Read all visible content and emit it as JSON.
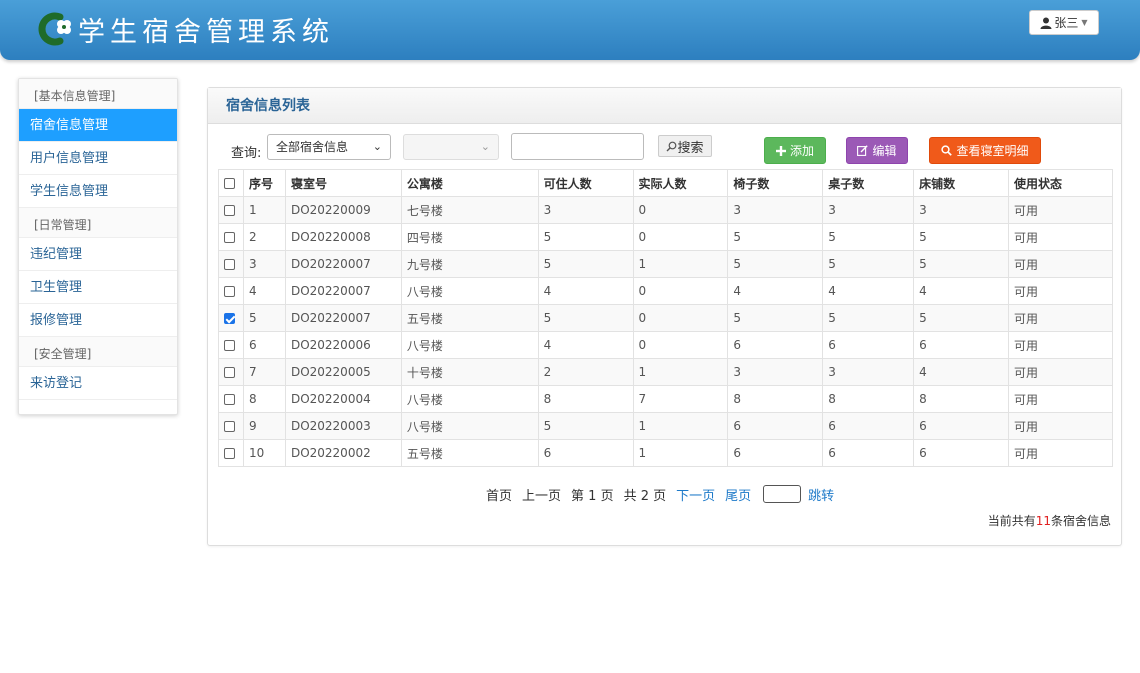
{
  "header": {
    "title": "学生宿舍管理系统",
    "user_label": "张三"
  },
  "sidebar": {
    "groups": [
      {
        "label": "[基本信息管理]",
        "items": [
          "宿舍信息管理",
          "用户信息管理",
          "学生信息管理"
        ]
      },
      {
        "label": "[日常管理]",
        "items": [
          "违纪管理",
          "卫生管理",
          "报修管理"
        ]
      },
      {
        "label": "[安全管理]",
        "items": [
          "来访登记"
        ]
      }
    ],
    "active_item": "宿舍信息管理"
  },
  "panel": {
    "title": "宿舍信息列表"
  },
  "toolbar": {
    "query_label": "查询:",
    "filter_select_value": "全部宿舍信息",
    "second_select_value": "",
    "search_input_value": "",
    "search_label": "搜索",
    "add_label": "添加",
    "edit_label": "编辑",
    "detail_label": "查看寝室明细"
  },
  "table": {
    "headers": [
      "序号",
      "寝室号",
      "公寓楼",
      "可住人数",
      "实际人数",
      "椅子数",
      "桌子数",
      "床铺数",
      "使用状态"
    ],
    "rows": [
      {
        "checked": false,
        "cells": [
          "1",
          "DO20220009",
          "七号楼",
          "3",
          "0",
          "3",
          "3",
          "3",
          "可用"
        ]
      },
      {
        "checked": false,
        "cells": [
          "2",
          "DO20220008",
          "四号楼",
          "5",
          "0",
          "5",
          "5",
          "5",
          "可用"
        ]
      },
      {
        "checked": false,
        "cells": [
          "3",
          "DO20220007",
          "九号楼",
          "5",
          "1",
          "5",
          "5",
          "5",
          "可用"
        ]
      },
      {
        "checked": false,
        "cells": [
          "4",
          "DO20220007",
          "八号楼",
          "4",
          "0",
          "4",
          "4",
          "4",
          "可用"
        ]
      },
      {
        "checked": true,
        "cells": [
          "5",
          "DO20220007",
          "五号楼",
          "5",
          "0",
          "5",
          "5",
          "5",
          "可用"
        ]
      },
      {
        "checked": false,
        "cells": [
          "6",
          "DO20220006",
          "八号楼",
          "4",
          "0",
          "6",
          "6",
          "6",
          "可用"
        ]
      },
      {
        "checked": false,
        "cells": [
          "7",
          "DO20220005",
          "十号楼",
          "2",
          "1",
          "3",
          "3",
          "4",
          "可用"
        ]
      },
      {
        "checked": false,
        "cells": [
          "8",
          "DO20220004",
          "八号楼",
          "8",
          "7",
          "8",
          "8",
          "8",
          "可用"
        ]
      },
      {
        "checked": false,
        "cells": [
          "9",
          "DO20220003",
          "八号楼",
          "5",
          "1",
          "6",
          "6",
          "6",
          "可用"
        ]
      },
      {
        "checked": false,
        "cells": [
          "10",
          "DO20220002",
          "五号楼",
          "6",
          "1",
          "6",
          "6",
          "6",
          "可用"
        ]
      }
    ]
  },
  "pagination": {
    "first": "首页",
    "prev": "上一页",
    "current": "第 1 页",
    "total_pages": "共 2 页",
    "next": "下一页",
    "last": "尾页",
    "jump_value": "",
    "jump_label": "跳转",
    "summary_prefix": "当前共有",
    "summary_count": "11",
    "summary_suffix": "条宿舍信息"
  },
  "colors": {
    "header_bg": "#2d7fbf",
    "active_item": "#1e9fff",
    "add_button": "#5cb85c",
    "edit_button": "#9b59b6",
    "detail_button": "#f05a1a",
    "link": "#1e7ac9",
    "count_highlight": "#e02020"
  },
  "icons": {
    "logo": "clover-c-logo",
    "user": "user-icon",
    "search": "search-icon",
    "add": "plus-icon",
    "edit": "edit-icon",
    "detail": "magnifier-icon"
  }
}
